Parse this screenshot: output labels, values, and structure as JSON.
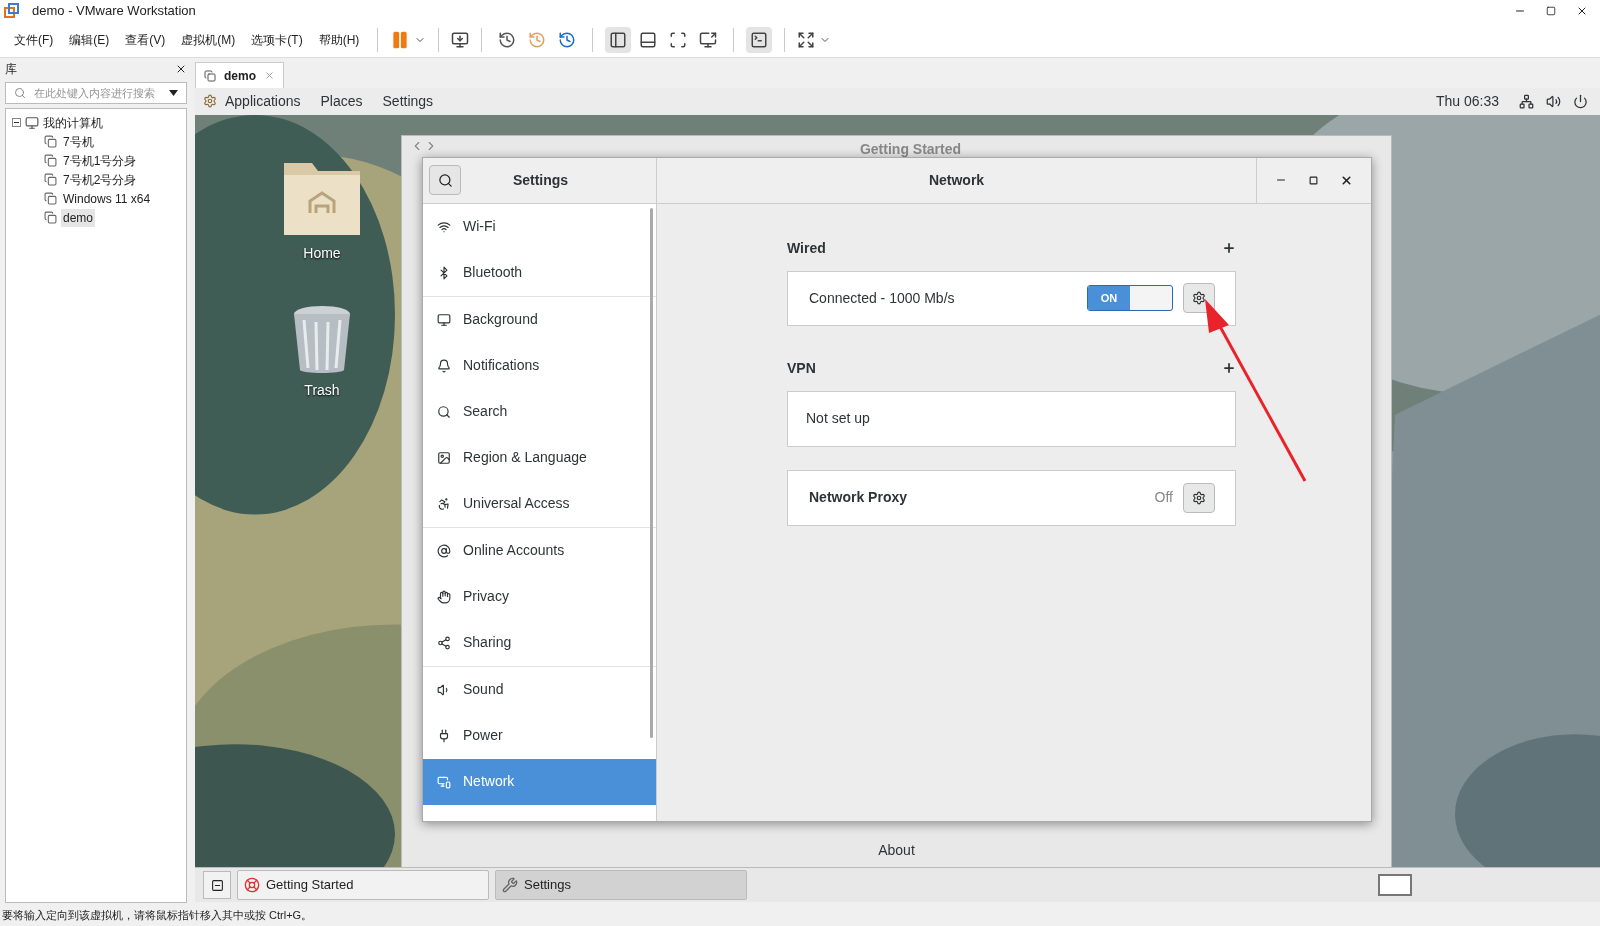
{
  "window": {
    "title": "demo - VMware Workstation"
  },
  "menu": [
    "文件(F)",
    "编辑(E)",
    "查看(V)",
    "虚拟机(M)",
    "选项卡(T)",
    "帮助(H)"
  ],
  "library": {
    "title": "库",
    "placeholder": "在此处键入内容进行搜索",
    "tree": [
      {
        "label": "我的计算机",
        "expanded": true,
        "children": [
          {
            "label": "7号机",
            "selected": false
          },
          {
            "label": "7号机1号分身",
            "selected": false
          },
          {
            "label": "7号机2号分身",
            "selected": false
          },
          {
            "label": "Windows 11 x64",
            "selected": false
          },
          {
            "label": "demo",
            "selected": true
          }
        ]
      }
    ]
  },
  "vm_tabs": [
    {
      "label": "demo",
      "selected": true
    }
  ],
  "guest_top_bar": {
    "menus": [
      "Applications",
      "Places",
      "Settings"
    ],
    "clock": "Thu 06:33"
  },
  "desktop_icons": [
    {
      "label": "Home",
      "kind": "folder"
    },
    {
      "label": "Trash",
      "kind": "trash"
    }
  ],
  "background_window": {
    "title": "Getting Started",
    "footer": "About"
  },
  "settings": {
    "sidebar_title": "Settings",
    "page_title": "Network",
    "sidebar_groups": [
      [
        {
          "label": "Wi-Fi",
          "selected": false
        },
        {
          "label": "Bluetooth",
          "selected": false
        }
      ],
      [
        {
          "label": "Background",
          "selected": false
        },
        {
          "label": "Notifications",
          "selected": false
        },
        {
          "label": "Search",
          "selected": false
        },
        {
          "label": "Region & Language",
          "selected": false
        },
        {
          "label": "Universal Access",
          "selected": false
        }
      ],
      [
        {
          "label": "Online Accounts",
          "selected": false
        },
        {
          "label": "Privacy",
          "selected": false
        },
        {
          "label": "Sharing",
          "selected": false
        }
      ],
      [
        {
          "label": "Sound",
          "selected": false
        },
        {
          "label": "Power",
          "selected": false
        },
        {
          "label": "Network",
          "selected": true
        }
      ]
    ],
    "wired": {
      "title": "Wired",
      "status": "Connected - 1000 Mb/s",
      "switch_label": "ON",
      "on": true
    },
    "vpn": {
      "title": "VPN",
      "text": "Not set up"
    },
    "proxy": {
      "label": "Network Proxy",
      "value": "Off"
    }
  },
  "taskbar": [
    {
      "label": "Getting Started",
      "selected": false
    },
    {
      "label": "Settings",
      "selected": true
    }
  ],
  "status_bar": "要将输入定向到该虚拟机，请将鼠标指针移入其中或按 Ctrl+G。"
}
